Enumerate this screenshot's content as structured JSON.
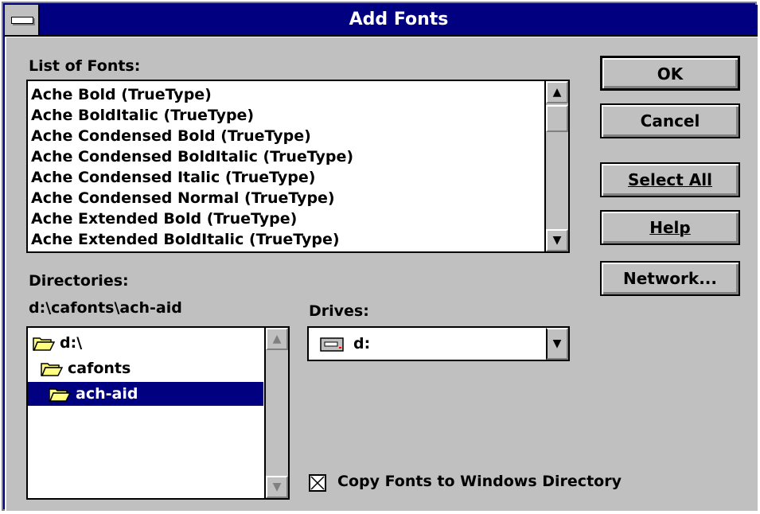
{
  "window": {
    "title": "Add Fonts"
  },
  "fonts": {
    "label": "List of Fonts:",
    "items": [
      "Ache Bold (TrueType)",
      "Ache BoldItalic (TrueType)",
      "Ache Condensed Bold (TrueType)",
      "Ache Condensed BoldItalic (TrueType)",
      "Ache Condensed Italic (TrueType)",
      "Ache Condensed Normal (TrueType)",
      "Ache Extended Bold (TrueType)",
      "Ache Extended BoldItalic (TrueType)"
    ]
  },
  "directories": {
    "label": "Directories:",
    "current_path": "d:\\cafonts\\ach-aid",
    "items": [
      "d:\\",
      "cafonts",
      "ach-aid"
    ],
    "selected": "ach-aid"
  },
  "drives": {
    "label": "Drives:",
    "value": "d:"
  },
  "checkbox": {
    "label": "Copy Fonts to Windows Directory",
    "checked": true
  },
  "buttons": {
    "ok": "OK",
    "cancel": "Cancel",
    "select_all": "Select All",
    "help": "Help",
    "network": "Network..."
  },
  "icons": {
    "system_menu": "system-menu-icon",
    "scroll_up": "up-arrow-icon",
    "scroll_down": "down-arrow-icon",
    "folder_open": "open-folder-icon",
    "drive": "drive-icon",
    "dropdown": "dropdown-arrow-icon"
  }
}
